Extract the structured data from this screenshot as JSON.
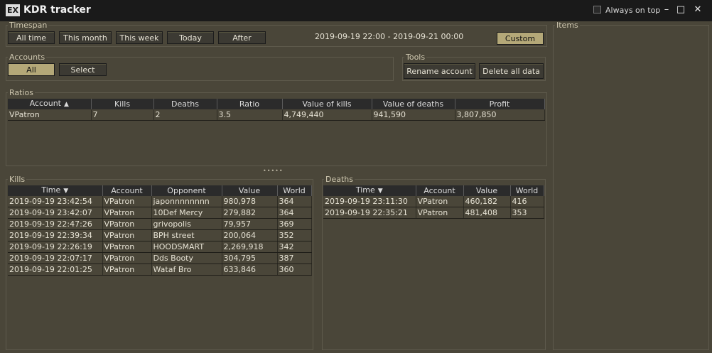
{
  "window": {
    "logo": "EX",
    "title": "KDR tracker",
    "always_on_top": "Always on top",
    "icons": {
      "minimize": "minimize-icon",
      "maximize": "maximize-icon",
      "close": "close-icon"
    }
  },
  "timespan": {
    "legend": "Timespan",
    "buttons": [
      "All time",
      "This month",
      "This week",
      "Today",
      "After"
    ],
    "range": "2019-09-19 22:00 - 2019-09-21 00:00",
    "custom": "Custom"
  },
  "accounts": {
    "legend": "Accounts",
    "all": "All",
    "select": "Select"
  },
  "tools": {
    "legend": "Tools",
    "rename": "Rename account",
    "delete": "Delete all data"
  },
  "items": {
    "legend": "Items"
  },
  "ratios": {
    "legend": "Ratios",
    "headers": [
      "Account",
      "Kills",
      "Deaths",
      "Ratio",
      "Value of kills",
      "Value of deaths",
      "Profit"
    ],
    "sort_icon": "▲",
    "rows": [
      [
        "VPatron",
        "7",
        "2",
        "3.5",
        "4,749,440",
        "941,590",
        "3,807,850"
      ]
    ]
  },
  "splitter": "•••••",
  "kills": {
    "legend": "Kills",
    "headers": [
      "Time",
      "Account",
      "Opponent",
      "Value",
      "World"
    ],
    "sort_icon": "▼",
    "rows": [
      [
        "2019-09-19 23:42:54",
        "VPatron",
        "japonnnnnnnn",
        "980,978",
        "364"
      ],
      [
        "2019-09-19 23:42:07",
        "VPatron",
        "10Def Mercy",
        "279,882",
        "364"
      ],
      [
        "2019-09-19 22:47:26",
        "VPatron",
        "grivopolis",
        "79,957",
        "369"
      ],
      [
        "2019-09-19 22:39:34",
        "VPatron",
        "BPH street",
        "200,064",
        "352"
      ],
      [
        "2019-09-19 22:26:19",
        "VPatron",
        "HOODSMART",
        "2,269,918",
        "342"
      ],
      [
        "2019-09-19 22:07:17",
        "VPatron",
        "Dds Booty",
        "304,795",
        "387"
      ],
      [
        "2019-09-19 22:01:25",
        "VPatron",
        "Wataf Bro",
        "633,846",
        "360"
      ]
    ]
  },
  "deaths": {
    "legend": "Deaths",
    "headers": [
      "Time",
      "Account",
      "Value",
      "World"
    ],
    "sort_icon": "▼",
    "rows": [
      [
        "2019-09-19 23:11:30",
        "VPatron",
        "460,182",
        "416"
      ],
      [
        "2019-09-19 22:35:21",
        "VPatron",
        "481,408",
        "353"
      ]
    ]
  }
}
